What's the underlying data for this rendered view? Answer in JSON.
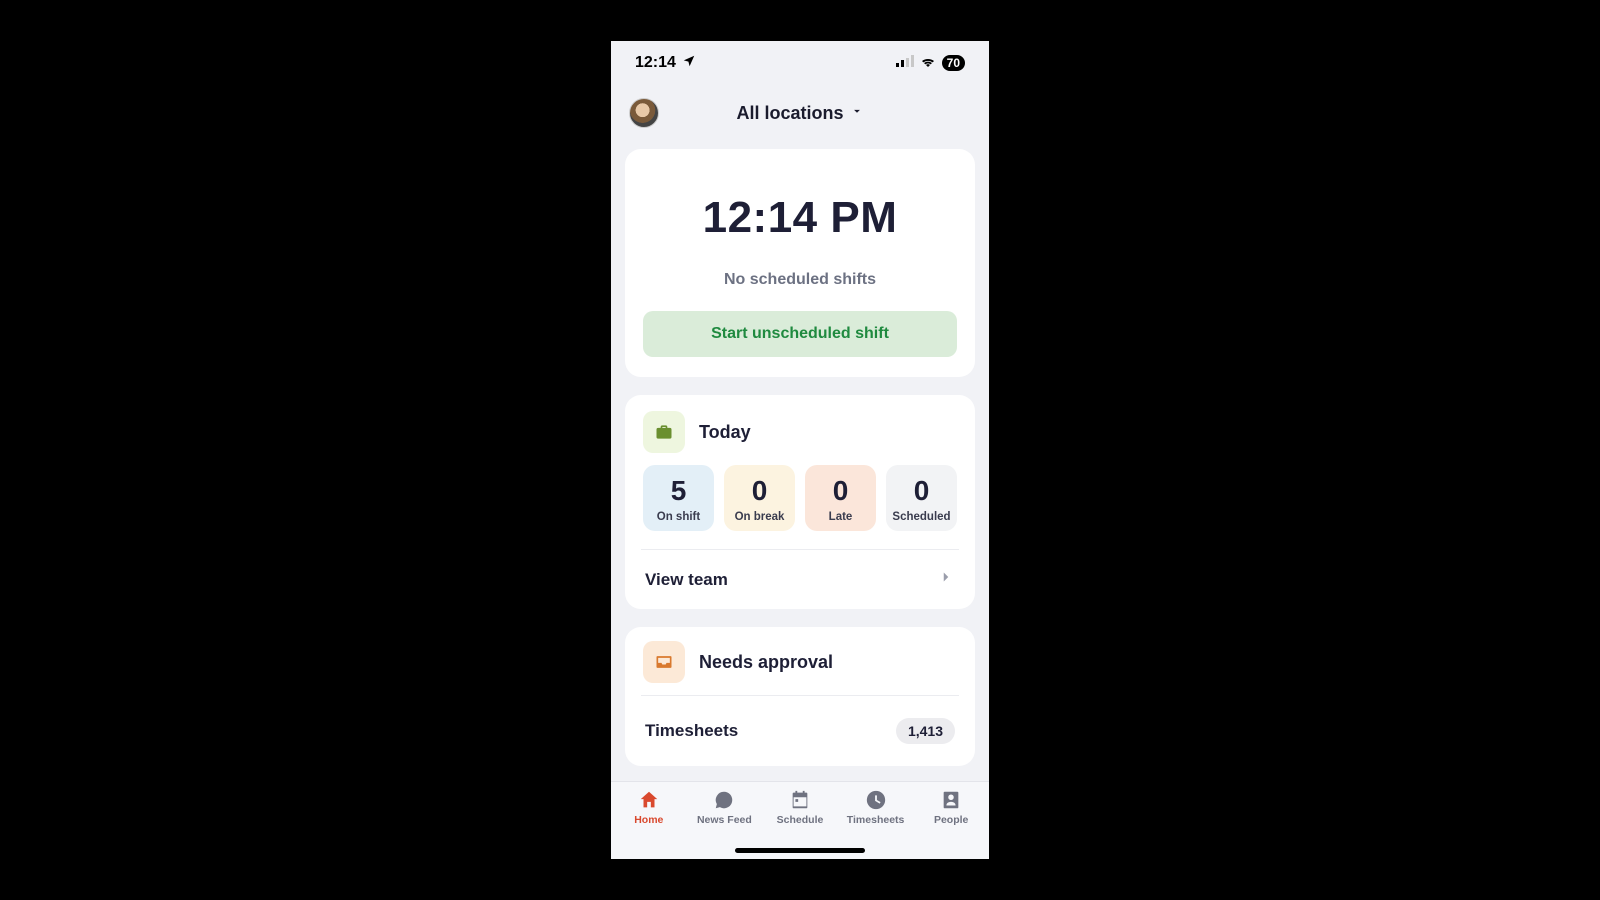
{
  "status": {
    "time": "12:14",
    "battery": "70"
  },
  "header": {
    "title": "All locations"
  },
  "clock": {
    "time": "12:14 PM",
    "subtitle": "No scheduled shifts",
    "button": "Start unscheduled shift"
  },
  "today": {
    "title": "Today",
    "stats": {
      "on_shift": {
        "value": "5",
        "label": "On shift"
      },
      "on_break": {
        "value": "0",
        "label": "On break"
      },
      "late": {
        "value": "0",
        "label": "Late"
      },
      "scheduled": {
        "value": "0",
        "label": "Scheduled"
      }
    },
    "view_team": "View team"
  },
  "approval": {
    "title": "Needs approval",
    "timesheets_label": "Timesheets",
    "timesheets_count": "1,413"
  },
  "tabs": {
    "home": "Home",
    "news": "News Feed",
    "schedule": "Schedule",
    "timesheets": "Timesheets",
    "people": "People"
  }
}
